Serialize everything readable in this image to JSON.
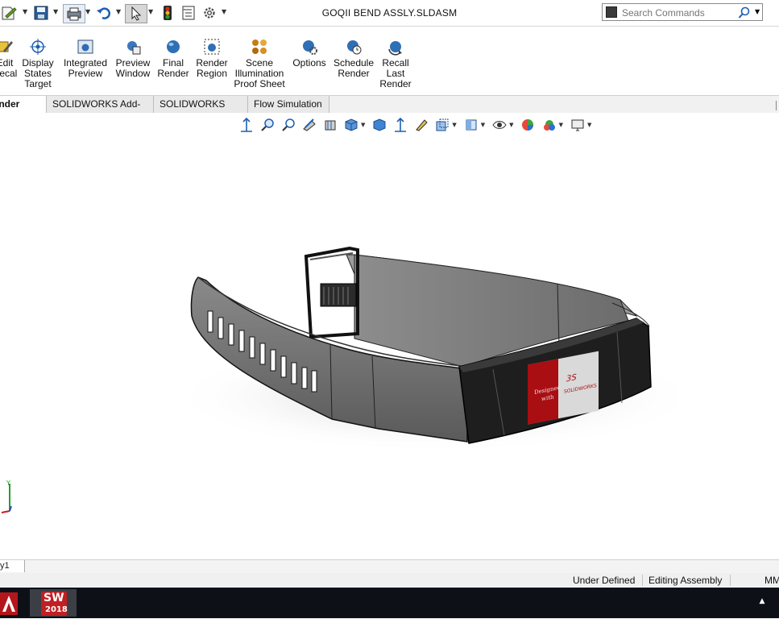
{
  "window": {
    "title": "GOQII BEND ASSLY.SLDASM"
  },
  "search": {
    "placeholder": "Search Commands"
  },
  "quick_access": [
    "new-icon",
    "save-icon",
    "print-icon",
    "undo-icon",
    "select-icon",
    "rebuild-icon",
    "file-properties-icon",
    "options-icon"
  ],
  "ribbon": {
    "items": [
      {
        "label": "Edit\nDecal",
        "icon": "edit-decal-icon"
      },
      {
        "label": "Display\nStates\nTarget",
        "icon": "display-states-target-icon"
      },
      {
        "label": "Integrated\nPreview",
        "icon": "integrated-preview-icon"
      },
      {
        "label": "Preview\nWindow",
        "icon": "preview-window-icon"
      },
      {
        "label": "Final\nRender",
        "icon": "final-render-icon"
      },
      {
        "label": "Render\nRegion",
        "icon": "render-region-icon"
      },
      {
        "label": "Scene\nIllumination\nProof Sheet",
        "icon": "scene-illumination-icon"
      },
      {
        "label": "Options",
        "icon": "options-icon"
      },
      {
        "label": "Schedule\nRender",
        "icon": "schedule-render-icon"
      },
      {
        "label": "Recall\nLast\nRender",
        "icon": "recall-last-render-icon"
      }
    ]
  },
  "tabs": [
    {
      "label": "Render Tools",
      "active": true
    },
    {
      "label": "SOLIDWORKS Add-Ins",
      "active": false
    },
    {
      "label": "SOLIDWORKS MBD",
      "active": false
    },
    {
      "label": "Flow Simulation",
      "active": false
    }
  ],
  "model": {
    "label_lines": [
      "Designed",
      "with"
    ],
    "label_brand": "SOLIDWORKS",
    "colors": {
      "band": "#7a7a7a",
      "band_dark": "#4b4b4b",
      "module": "#1c1c1c",
      "screen_red": "#a80e12",
      "screen_light": "#d9d9d9"
    }
  },
  "sheet_tab": {
    "label": "y1"
  },
  "status": {
    "state": "Under Defined",
    "mode": "Editing Assembly",
    "units": "MM"
  },
  "taskbar": {
    "app_label": "2018",
    "app_badge": "SW"
  }
}
